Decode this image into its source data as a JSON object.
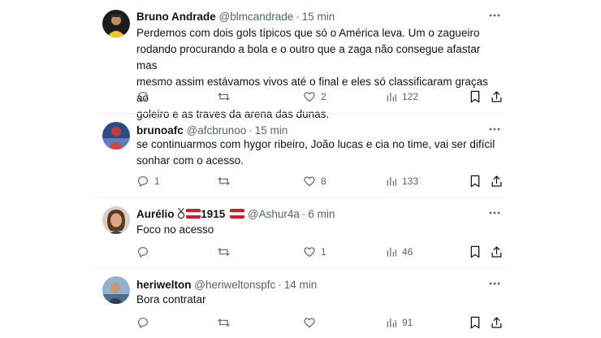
{
  "tweets": [
    {
      "name": "Bruno Andrade",
      "handle": "@blmcandrade",
      "time": "15 min",
      "lines": [
        "Perdemos com dois gols típicos que só o América leva. Um o zagueiro",
        "rodando procurando a bola e o outro que a zaga não consegue afastar mas",
        "mesmo assim estávamos vivos até o final e eles só classificaram graças ao",
        "goleiro e as traves da arena das dunas."
      ],
      "replies": "",
      "retweets": "",
      "likes": "2",
      "views": "122",
      "avatar_color": "#f2c230"
    },
    {
      "name": "brunoafc",
      "handle": "@afcbrunoo",
      "time": "15 min",
      "lines": [
        "se continuarmos com hygor ribeiro, João lucas e cia no time, vai ser difícil",
        "sonhar com o acesso."
      ],
      "replies": "1",
      "retweets": "",
      "likes": "8",
      "views": "133",
      "avatar_color": "#3b5ea8"
    },
    {
      "name_prefix": "Aurélio",
      "name_suffix": "1915",
      "handle": "@Ashur4a",
      "time": "6 min",
      "lines": [
        "Foco no acesso"
      ],
      "replies": "",
      "retweets": "",
      "likes": "1",
      "views": "46",
      "avatar_color": "#b88a6a"
    },
    {
      "name": "heriwelton",
      "handle": "@heriweltonspfc",
      "time": "14 min",
      "lines": [
        "Bora contratar"
      ],
      "replies": "",
      "retweets": "",
      "likes": "",
      "views": "91",
      "avatar_color": "#6e8aa3"
    }
  ],
  "separator": "·",
  "icons": {
    "reply": "reply-icon",
    "retweet": "retweet-icon",
    "like": "heart-icon",
    "views": "views-icon",
    "bookmark": "bookmark-icon",
    "share": "share-icon",
    "more": "more-icon"
  },
  "colors": {
    "text": "#0f1419",
    "secondary": "#536471",
    "divider": "#eff3f4",
    "flag_red": "#d71a28"
  }
}
